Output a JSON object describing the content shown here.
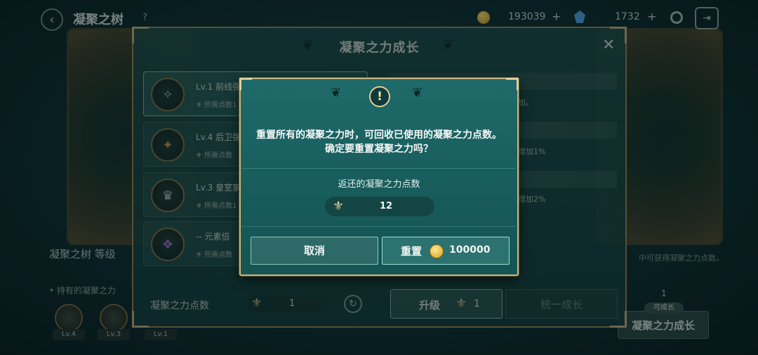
{
  "background": {
    "title": "凝聚之树",
    "help_mark": "?",
    "gold_amount": "193039",
    "gem_amount": "1732",
    "plus_label": "+",
    "left_info": "凝聚之树 等级",
    "owned_label": "• 持有的凝聚之力",
    "node_levels": [
      "Lv.4",
      "Lv.3",
      "Lv.1"
    ],
    "right_hint": "中可获得凝聚之力点数。",
    "right_count": "1",
    "right_button": "凝聚之力成长",
    "right_badge": "可成长"
  },
  "panel": {
    "title": "凝聚之力成长",
    "close_glyph": "✕",
    "items": [
      {
        "name": "Lv.1 前线强",
        "req": "所需点数1"
      },
      {
        "name": "Lv.4 后卫强",
        "req": "所需点数"
      },
      {
        "name": "Lv.3 皇室家",
        "req": "所需点数1"
      },
      {
        "name": "-- 元素倍",
        "req": "所需点数"
      }
    ],
    "right_rows": [
      "加。",
      "增加1%",
      "增加2%"
    ],
    "points_label": "凝聚之力点数",
    "points_value": "1",
    "upgrade_label": "升级",
    "upgrade_value": "1",
    "unify_label": "统一成长"
  },
  "dialog": {
    "alert_glyph": "!",
    "message_line1": "重置所有的凝聚之力时，可回收已使用的凝聚之力点数。",
    "message_line2": "确定要重置凝聚之力吗？",
    "refund_label": "返还的凝聚之力点数",
    "refund_value": "12",
    "cancel_label": "取消",
    "reset_label": "重置",
    "reset_cost": "100000"
  },
  "colors": {
    "dialog_bg": "#1f6a6a",
    "gold_border": "#c9b57a",
    "coin": "#d4a21f"
  },
  "icons": {
    "fleur": "fleur-de-lis-icon",
    "coin": "gold-coin-icon",
    "gem": "gem-icon",
    "alert": "exclamation-icon"
  }
}
